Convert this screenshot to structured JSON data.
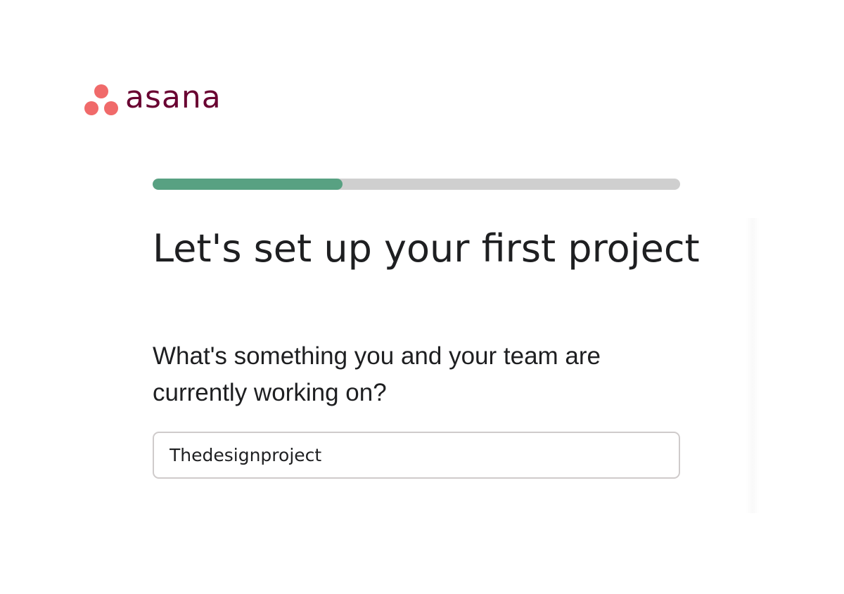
{
  "brand": {
    "name": "asana",
    "logo_icon": "asana-three-dots-icon",
    "dot_color": "#f06a6a",
    "wordmark_color": "#690031"
  },
  "progress": {
    "value_percent": 36,
    "fill_color": "#58a182",
    "track_color": "#cfcfcf"
  },
  "title": "Let's set up your first project",
  "question": "What's something you and your team are currently working on?",
  "project_input": {
    "value": "Thedesignproject",
    "placeholder": ""
  }
}
